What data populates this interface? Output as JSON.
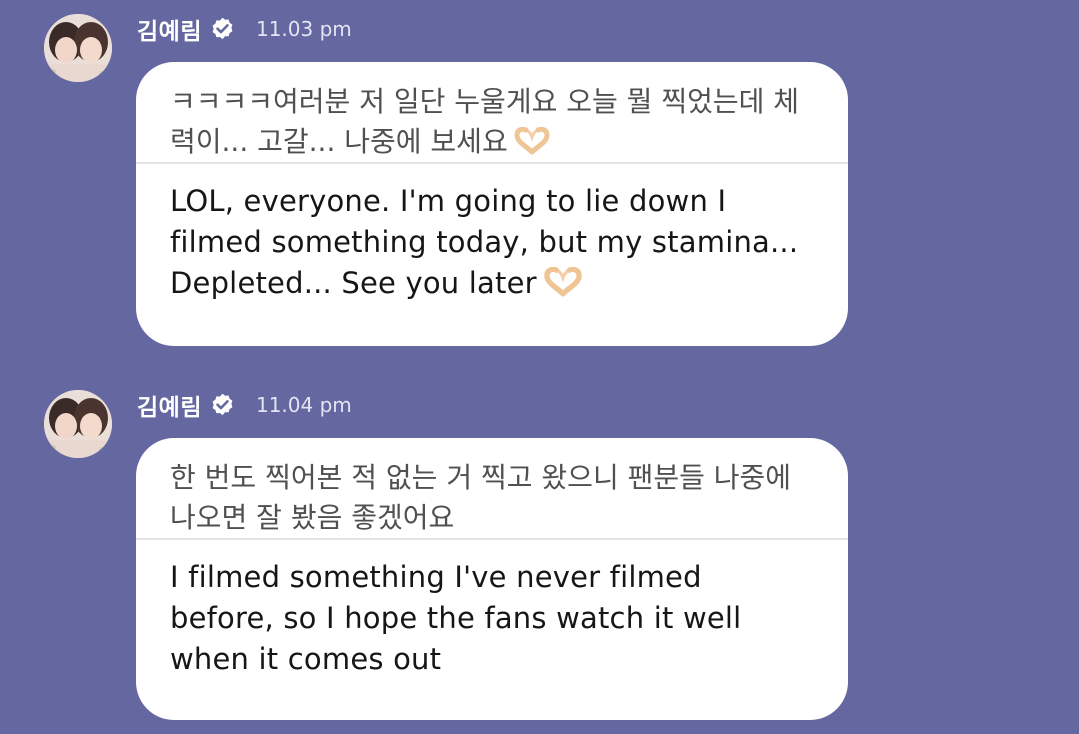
{
  "messages": [
    {
      "sender": "김예림",
      "time": "11.03 pm",
      "original": "ㅋㅋㅋㅋ여러분 저 일단 누울게요 오늘 뭘 찍었는데 체력이... 고갈... 나중에 보세요",
      "translation": "LOL, everyone. I'm going to lie down I filmed something today, but my stamina... Depleted... See you later",
      "emoji": "heart-hands-icon"
    },
    {
      "sender": "김예림",
      "time": "11.04 pm",
      "original": "한 번도 찍어본 적 없는 거 찍고 왔으니 팬분들 나중에 나오면 잘 봤음 좋겠어요",
      "translation": "I filmed something I've never filmed before, so I hope the fans watch it well when it comes out"
    }
  ],
  "colors": {
    "background": "#6567a0",
    "bubble": "#ffffff",
    "verified": "#ffffff"
  }
}
